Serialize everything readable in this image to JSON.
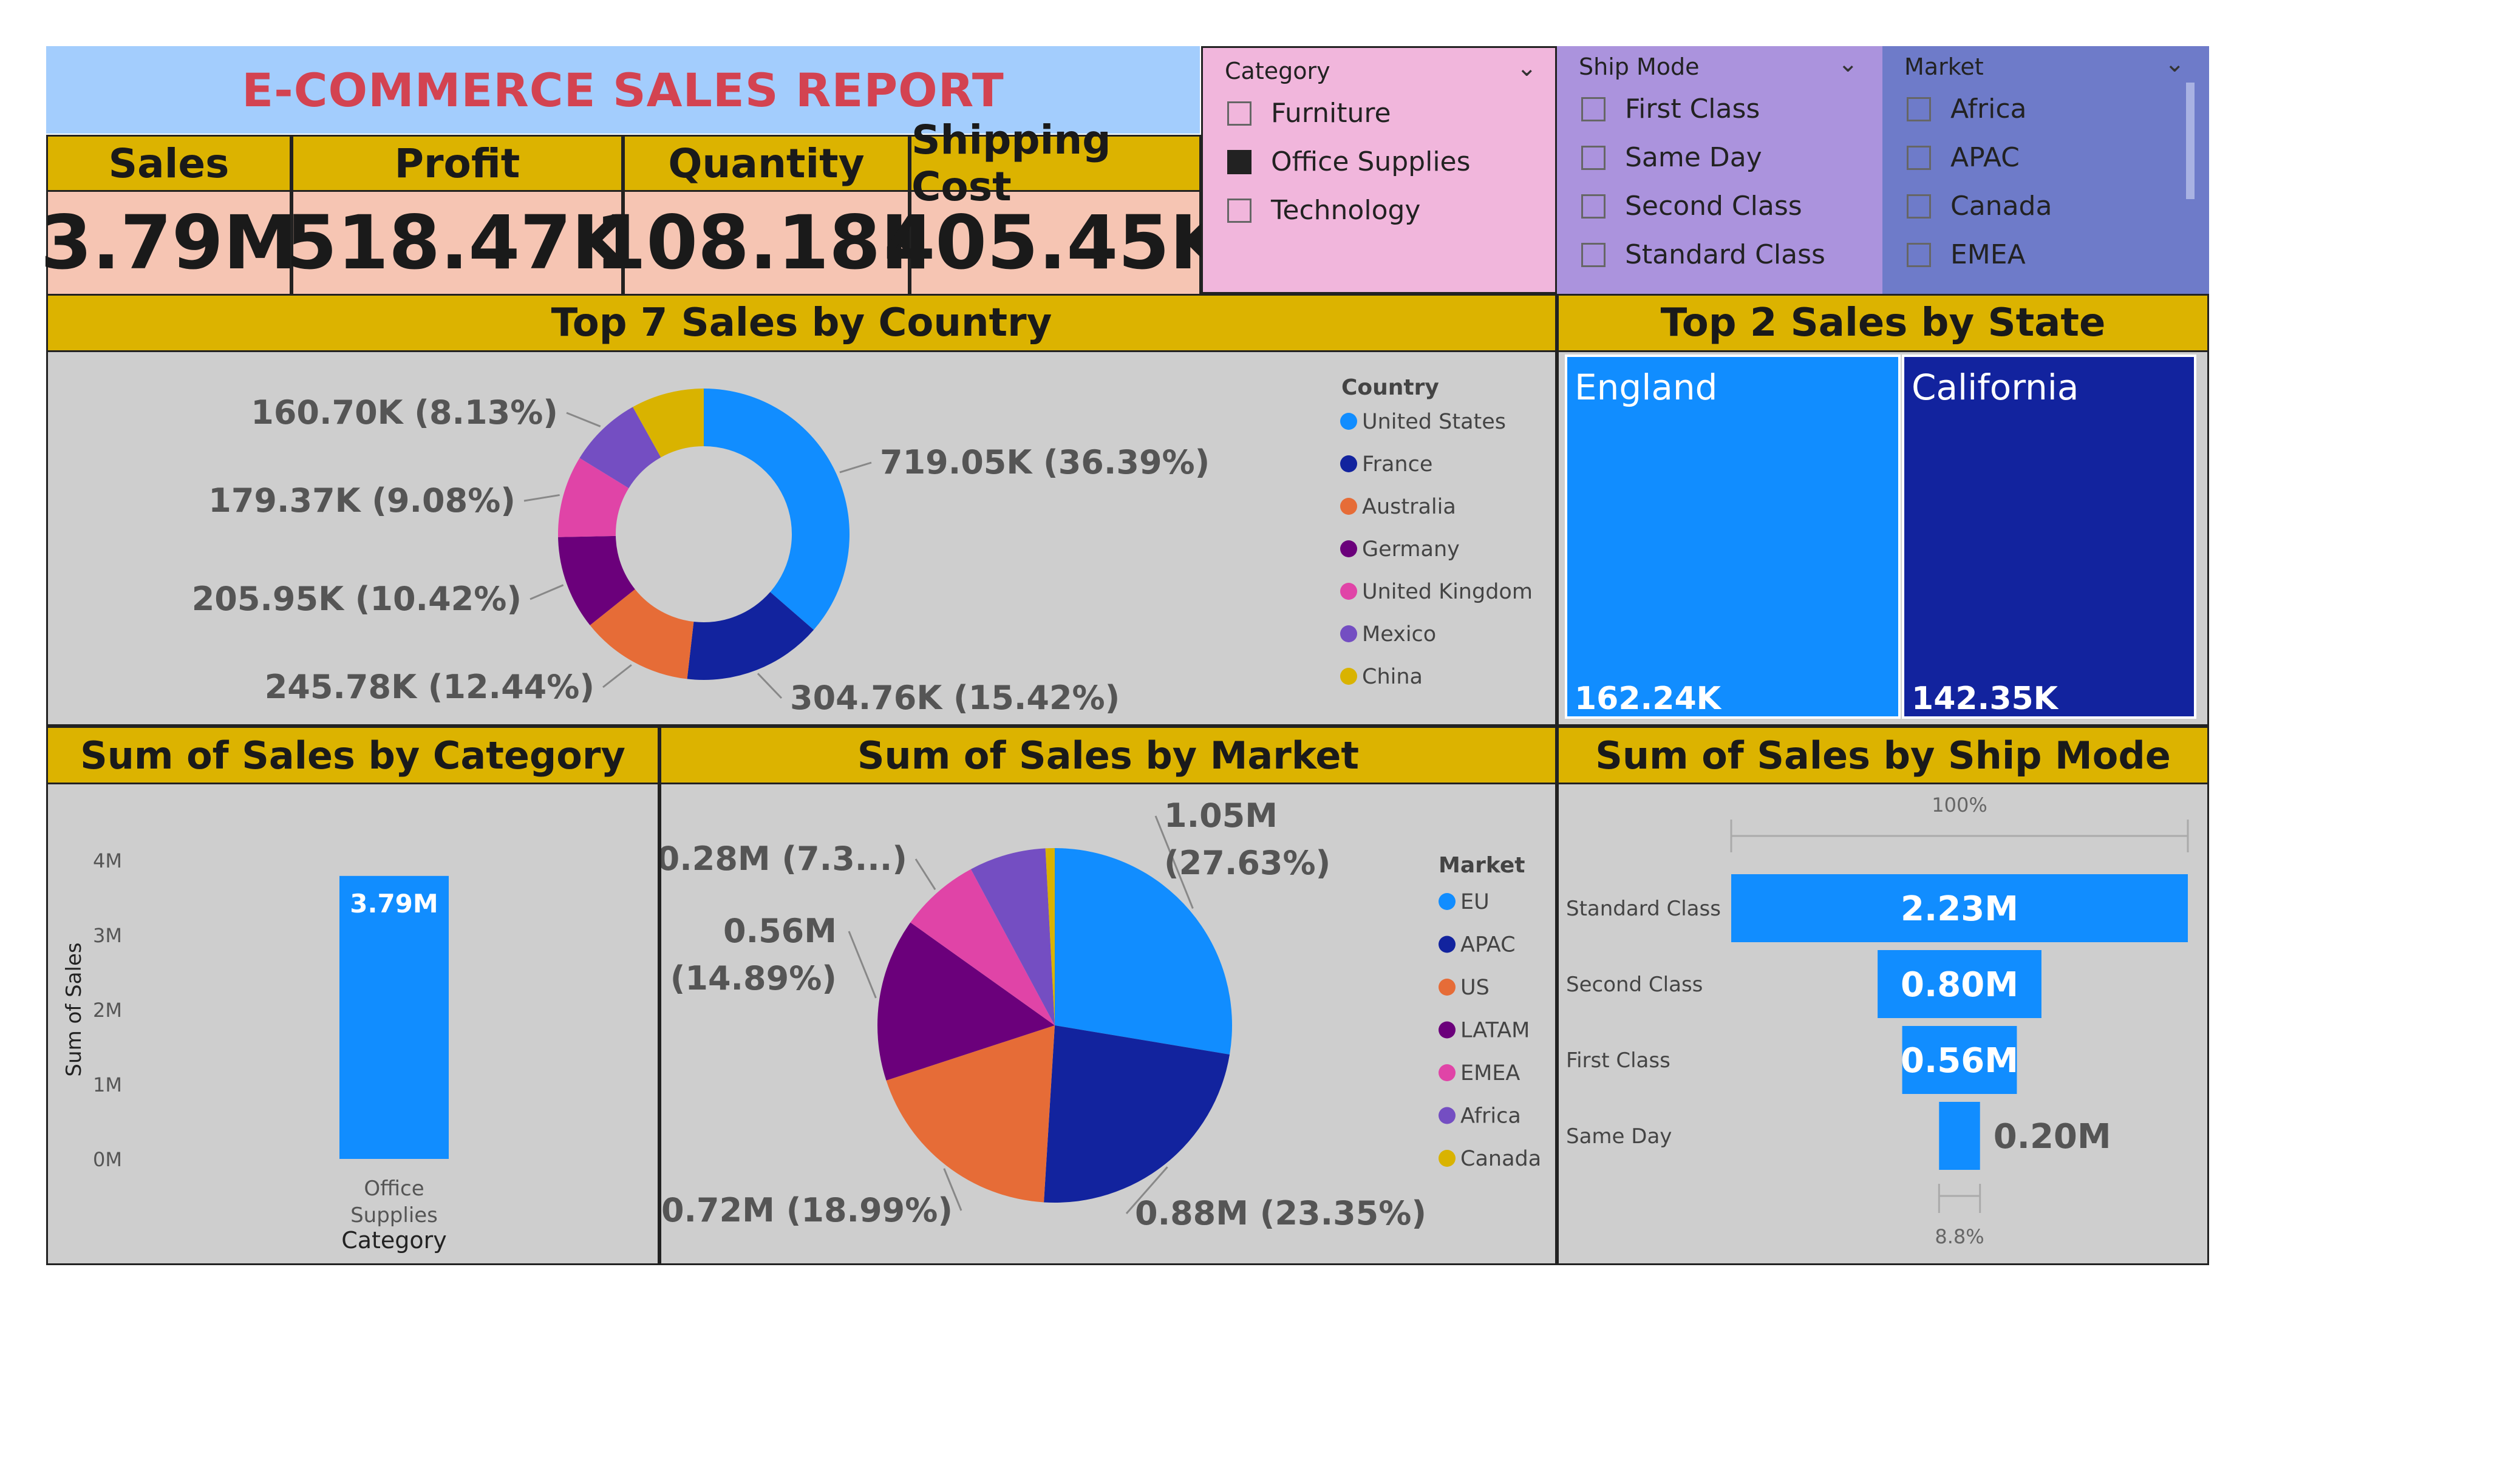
{
  "report_title": "E-COMMERCE SALES REPORT",
  "kpis": [
    {
      "label": "Sales",
      "value": "3.79M"
    },
    {
      "label": "Profit",
      "value": "518.47K"
    },
    {
      "label": "Quantity",
      "value": "108.18K"
    },
    {
      "label": "Shipping Cost",
      "value": "405.45K"
    }
  ],
  "slicers": {
    "category": {
      "title": "Category",
      "items": [
        {
          "label": "Furniture",
          "checked": false
        },
        {
          "label": "Office Supplies",
          "checked": true
        },
        {
          "label": "Technology",
          "checked": false
        }
      ],
      "bg": "#f1b6dc"
    },
    "ship_mode": {
      "title": "Ship Mode",
      "items": [
        {
          "label": "First Class",
          "checked": false
        },
        {
          "label": "Same Day",
          "checked": false
        },
        {
          "label": "Second Class",
          "checked": false
        },
        {
          "label": "Standard Class",
          "checked": false
        }
      ],
      "bg": "#ab93dd"
    },
    "market": {
      "title": "Market",
      "items": [
        {
          "label": "Africa",
          "checked": false
        },
        {
          "label": "APAC",
          "checked": false
        },
        {
          "label": "Canada",
          "checked": false
        },
        {
          "label": "EMEA",
          "checked": false
        }
      ],
      "bg": "#6e7bc9"
    }
  },
  "colors": {
    "blue": "#118dff",
    "navy": "#12239e",
    "orange": "#e66c37",
    "purple": "#6b007b",
    "pink": "#e044a7",
    "violet": "#744ec2",
    "gold": "#d9b300"
  },
  "chart_data": [
    {
      "type": "donut",
      "title": "Top 7 Sales by Country",
      "legend_title": "Country",
      "legend_position": "right",
      "slices": [
        {
          "name": "United States",
          "value": 719.05,
          "label": "719.05K (36.39%)",
          "color": "#118dff"
        },
        {
          "name": "France",
          "value": 304.76,
          "label": "304.76K (15.42%)",
          "color": "#12239e"
        },
        {
          "name": "Australia",
          "value": 245.78,
          "label": "245.78K (12.44%)",
          "color": "#e66c37"
        },
        {
          "name": "Germany",
          "value": 205.95,
          "label": "205.95K (10.42%)",
          "color": "#6b007b"
        },
        {
          "name": "United Kingdom",
          "value": 179.37,
          "label": "179.37K (9.08%)",
          "color": "#e044a7"
        },
        {
          "name": "Mexico",
          "value": 160.7,
          "label": "160.70K (8.13%)",
          "color": "#744ec2"
        },
        {
          "name": "China",
          "value": 160.0,
          "label": "",
          "color": "#d9b300"
        }
      ]
    },
    {
      "type": "treemap",
      "title": "Top 2 Sales by State",
      "items": [
        {
          "name": "England",
          "value": 162.24,
          "label": "162.24K",
          "color": "#118dff"
        },
        {
          "name": "California",
          "value": 142.35,
          "label": "142.35K",
          "color": "#12239e"
        }
      ]
    },
    {
      "type": "bar",
      "title": "Sum of Sales by Category",
      "categories": [
        "Office Supplies"
      ],
      "category_lines": [
        "Office",
        "Supplies"
      ],
      "values": [
        3.79
      ],
      "data_labels": [
        "3.79M"
      ],
      "xlabel": "Category",
      "ylabel": "Sum of Sales",
      "ylim": [
        0,
        4
      ],
      "yticks": [
        0,
        1,
        2,
        3,
        4
      ],
      "ytick_labels": [
        "0M",
        "1M",
        "2M",
        "3M",
        "4M"
      ],
      "color": "#118dff"
    },
    {
      "type": "pie",
      "title": "Sum of Sales by Market",
      "legend_title": "Market",
      "legend_position": "right",
      "slices": [
        {
          "name": "EU",
          "value": 27.63,
          "label": [
            "1.05M",
            "(27.63%)"
          ],
          "color": "#118dff"
        },
        {
          "name": "APAC",
          "value": 23.35,
          "label": [
            "0.88M (23.35%)"
          ],
          "color": "#12239e"
        },
        {
          "name": "US",
          "value": 18.99,
          "label": [
            "0.72M (18.99%)"
          ],
          "color": "#e66c37"
        },
        {
          "name": "LATAM",
          "value": 14.89,
          "label": [
            "0.56M",
            "(14.89%)"
          ],
          "color": "#6b007b"
        },
        {
          "name": "EMEA",
          "value": 7.3,
          "label": [
            "0.28M (7.3...)"
          ],
          "color": "#e044a7"
        },
        {
          "name": "Africa",
          "value": 7.0,
          "label": [],
          "color": "#744ec2"
        },
        {
          "name": "Canada",
          "value": 0.84,
          "label": [],
          "color": "#d9b300"
        }
      ]
    },
    {
      "type": "funnel",
      "title": "Sum of Sales by Ship Mode",
      "top_label": "100%",
      "bottom_label": "8.8%",
      "stages": [
        {
          "name": "Standard Class",
          "value": 2.23,
          "label": "2.23M"
        },
        {
          "name": "Second Class",
          "value": 0.8,
          "label": "0.80M"
        },
        {
          "name": "First Class",
          "value": 0.56,
          "label": "0.56M"
        },
        {
          "name": "Same Day",
          "value": 0.2,
          "label": "0.20M"
        }
      ],
      "color": "#118dff"
    }
  ]
}
